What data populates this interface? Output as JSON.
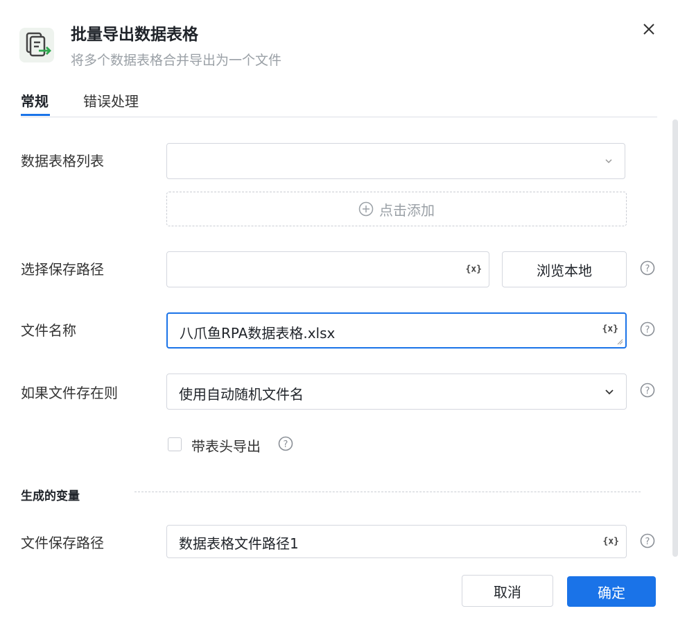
{
  "header": {
    "title": "批量导出数据表格",
    "subtitle": "将多个数据表格合并导出为一个文件",
    "icon": "export-table-icon"
  },
  "tabs": [
    {
      "label": "常规",
      "active": true
    },
    {
      "label": "错误处理",
      "active": false
    }
  ],
  "form": {
    "table_list": {
      "label": "数据表格列表",
      "value": "",
      "add_label": "点击添加"
    },
    "save_path": {
      "label": "选择保存路径",
      "value": "",
      "browse_label": "浏览本地"
    },
    "file_name": {
      "label": "文件名称",
      "value": "八爪鱼RPA数据表格.xlsx"
    },
    "if_exists": {
      "label": "如果文件存在则",
      "value": "使用自动随机文件名"
    },
    "with_header": {
      "label": "带表头导出",
      "checked": false
    }
  },
  "variables": {
    "section_label": "生成的变量",
    "file_save_path": {
      "label": "文件保存路径",
      "value": "数据表格文件路径1"
    }
  },
  "var_button": "{x}",
  "footer": {
    "cancel": "取消",
    "confirm": "确定"
  },
  "colors": {
    "primary": "#1a73e8",
    "icon_green": "#2fa84f"
  }
}
